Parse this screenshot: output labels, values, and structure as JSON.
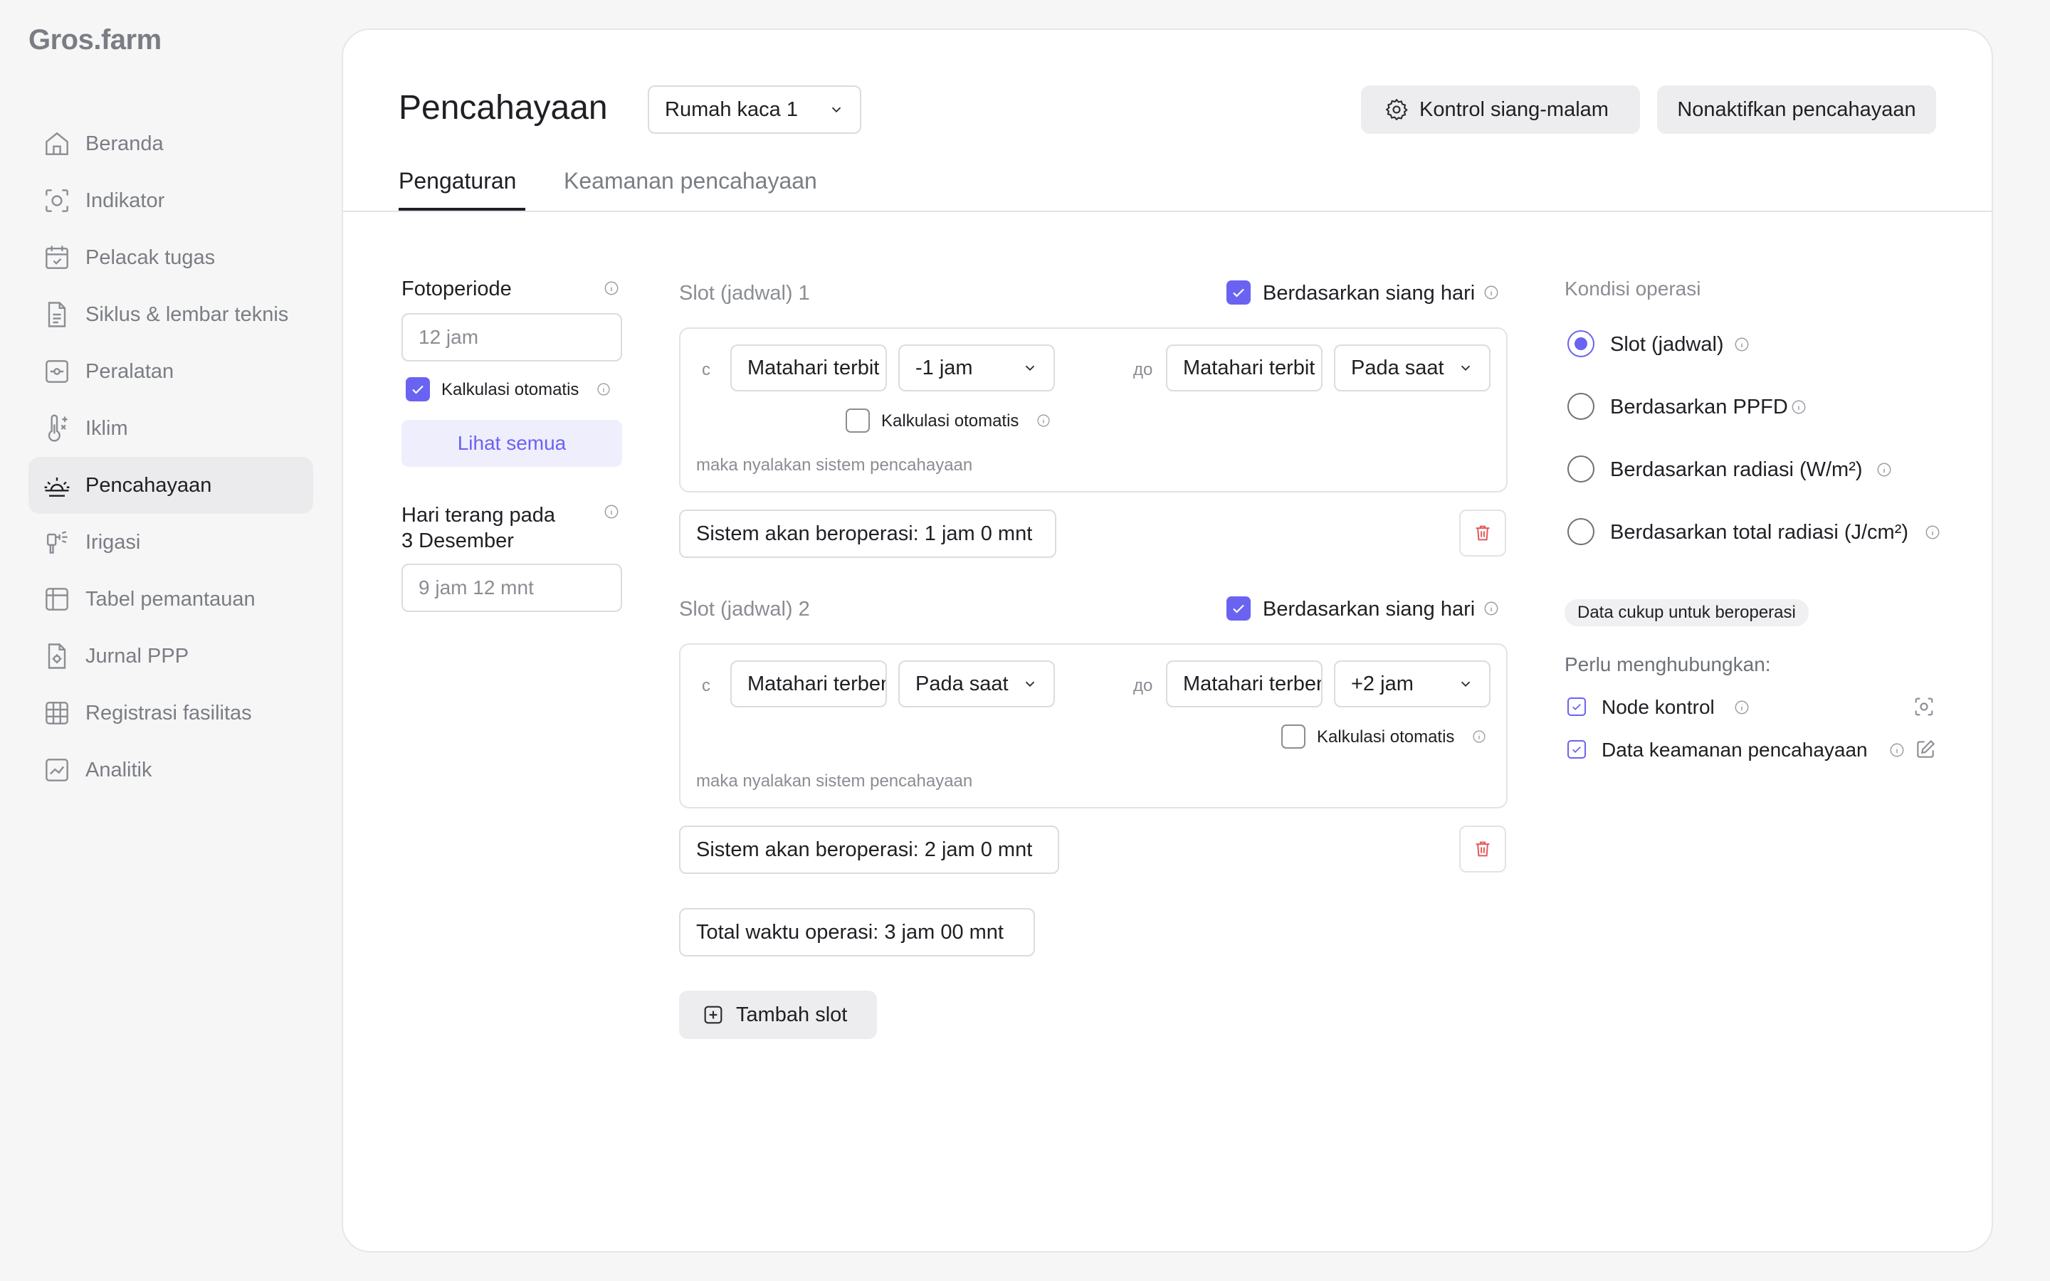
{
  "app": {
    "logo": "Gros.farm"
  },
  "sidebar": {
    "items": [
      {
        "label": "Beranda",
        "icon": "home-icon"
      },
      {
        "label": "Indikator",
        "icon": "indicator-icon"
      },
      {
        "label": "Pelacak tugas",
        "icon": "calendar-check-icon"
      },
      {
        "label": "Siklus & lembar teknis",
        "icon": "document-icon"
      },
      {
        "label": "Peralatan",
        "icon": "equipment-icon"
      },
      {
        "label": "Iklim",
        "icon": "thermometer-icon"
      },
      {
        "label": "Pencahayaan",
        "icon": "sunrise-icon",
        "active": true
      },
      {
        "label": "Irigasi",
        "icon": "sprinkler-icon"
      },
      {
        "label": "Tabel pemantauan",
        "icon": "table-icon"
      },
      {
        "label": "Jurnal PPP",
        "icon": "journal-icon"
      },
      {
        "label": "Registrasi fasilitas",
        "icon": "grid-icon"
      },
      {
        "label": "Analitik",
        "icon": "analytics-icon"
      }
    ]
  },
  "header": {
    "title": "Pencahayaan",
    "greenhouse_select": "Rumah kaca 1",
    "day_night_button": "Kontrol siang-malam",
    "disable_button": "Nonaktifkan pencahayaan",
    "tabs": [
      "Pengaturan",
      "Keamanan pencahayaan"
    ]
  },
  "left_panel": {
    "photoperiod_label": "Fotoperiode",
    "photoperiod_placeholder": "12 jam",
    "auto_calc_label": "Kalkulasi otomatis",
    "see_all_button": "Lihat semua",
    "daylight_label_line1": "Hari terang pada",
    "daylight_label_line2": "3 Desember",
    "daylight_placeholder": "9 jam 12 mnt"
  },
  "slots": [
    {
      "title": "Slot (jadwal) 1",
      "daylight_based_label": "Berdasarkan siang hari",
      "daylight_based": true,
      "from_prefix": "с",
      "from_event": "Matahari terbit",
      "from_offset": "-1 jam",
      "to_prefix": "до",
      "to_event": "Matahari terbit",
      "to_offset": "Pada saat",
      "auto_calc_label": "Kalkulasi otomatis",
      "auto_calc": false,
      "note": "maka nyalakan sistem pencahayaan",
      "runtime": "Sistem akan beroperasi: 1 jam 0 mnt"
    },
    {
      "title": "Slot (jadwal) 2",
      "daylight_based_label": "Berdasarkan siang hari",
      "daylight_based": true,
      "from_prefix": "с",
      "from_event": "Matahari terben",
      "from_offset": "Pada saat",
      "to_prefix": "до",
      "to_event": "Matahari terben",
      "to_offset": "+2 jam",
      "auto_calc_label": "Kalkulasi otomatis",
      "auto_calc": false,
      "note": "maka nyalakan sistem pencahayaan",
      "runtime": "Sistem akan beroperasi: 2 jam 0 mnt"
    }
  ],
  "total": "Total waktu operasi: 3 jam 00 mnt",
  "add_slot": "Tambah slot",
  "conditions": {
    "title": "Kondisi operasi",
    "options": [
      {
        "label": "Slot (jadwal)",
        "selected": true
      },
      {
        "label": "Berdasarkan PPFD",
        "selected": false
      },
      {
        "label": "Berdasarkan radiasi (W/m²)",
        "selected": false
      },
      {
        "label": "Berdasarkan total radiasi (J/cm²)",
        "selected": false
      }
    ],
    "data_badge": "Data cukup untuk beroperasi",
    "connect_title": "Perlu menghubungkan:",
    "connect_items": [
      {
        "label": "Node kontrol",
        "action_icon": "scan-icon"
      },
      {
        "label": "Data keamanan pencahayaan",
        "action_icon": "edit-icon"
      }
    ]
  },
  "colors": {
    "accent": "#6a63f2",
    "danger": "#e25a5a",
    "muted": "#8a8d93"
  }
}
